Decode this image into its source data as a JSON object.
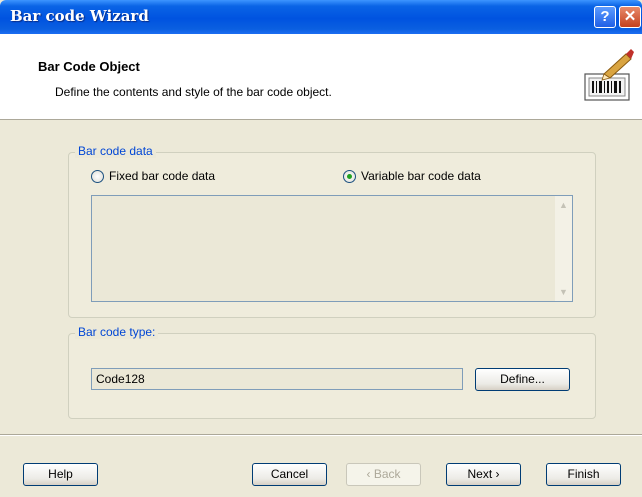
{
  "window": {
    "title": "Bar code Wizard",
    "help_glyph": "?",
    "close_glyph": "✕"
  },
  "header": {
    "title": "Bar Code Object",
    "description": "Define the contents and style of the bar code object.",
    "icon": "barcode-wizard-icon"
  },
  "data_group": {
    "legend": "Bar code data",
    "options": [
      {
        "label": "Fixed bar code data",
        "selected": false
      },
      {
        "label": "Variable bar code data",
        "selected": true
      }
    ],
    "text_value": ""
  },
  "type_group": {
    "legend": "Bar code type:",
    "value": "Code128",
    "define_label": "Define..."
  },
  "footer": {
    "help_label": "Help",
    "cancel_label": "Cancel",
    "back_label": "‹ Back",
    "next_label": "Next ›",
    "finish_label": "Finish"
  }
}
